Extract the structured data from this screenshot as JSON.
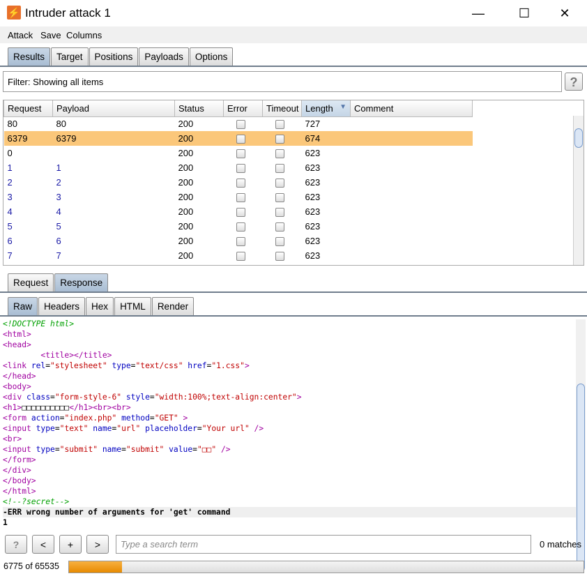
{
  "window": {
    "title": "Intruder attack 1",
    "minimize": "—",
    "maximize": "☐",
    "close": "✕"
  },
  "menu": [
    "Attack",
    "Save",
    "Columns"
  ],
  "tabs": [
    "Results",
    "Target",
    "Positions",
    "Payloads",
    "Options"
  ],
  "filter": {
    "text": "Filter: Showing all items",
    "help": "?"
  },
  "table": {
    "columns": [
      "Request",
      "Payload",
      "Status",
      "Error",
      "Timeout",
      "Length",
      "Comment"
    ],
    "sort_column": "Length",
    "sort_icon": "▼",
    "rows": [
      {
        "request": "80",
        "payload": "80",
        "status": "200",
        "length": "727",
        "selected": false
      },
      {
        "request": "6379",
        "payload": "6379",
        "status": "200",
        "length": "674",
        "selected": true
      },
      {
        "request": "0",
        "payload": "",
        "status": "200",
        "length": "623",
        "selected": false
      },
      {
        "request": "1",
        "payload": "1",
        "status": "200",
        "length": "623",
        "selected": false
      },
      {
        "request": "2",
        "payload": "2",
        "status": "200",
        "length": "623",
        "selected": false
      },
      {
        "request": "3",
        "payload": "3",
        "status": "200",
        "length": "623",
        "selected": false
      },
      {
        "request": "4",
        "payload": "4",
        "status": "200",
        "length": "623",
        "selected": false
      },
      {
        "request": "5",
        "payload": "5",
        "status": "200",
        "length": "623",
        "selected": false
      },
      {
        "request": "6",
        "payload": "6",
        "status": "200",
        "length": "623",
        "selected": false
      },
      {
        "request": "7",
        "payload": "7",
        "status": "200",
        "length": "623",
        "selected": false
      }
    ]
  },
  "reqresp_tabs": [
    "Request",
    "Response"
  ],
  "view_tabs": [
    "Raw",
    "Headers",
    "Hex",
    "HTML",
    "Render"
  ],
  "code": [
    [
      [
        "com",
        "<!DOCTYPE html>"
      ]
    ],
    [
      [
        "tag",
        "<html>"
      ]
    ],
    [
      [
        "tag",
        "<head>"
      ]
    ],
    [
      [
        "plain",
        "        "
      ],
      [
        "tag",
        "<title></title>"
      ]
    ],
    [
      [
        "tag",
        "<link "
      ],
      [
        "attr",
        "rel"
      ],
      [
        "plain",
        "="
      ],
      [
        "val",
        "\"stylesheet\""
      ],
      [
        "attr",
        " type"
      ],
      [
        "plain",
        "="
      ],
      [
        "val",
        "\"text/css\""
      ],
      [
        "attr",
        " href"
      ],
      [
        "plain",
        "="
      ],
      [
        "val",
        "\"1.css\""
      ],
      [
        "tag",
        ">"
      ]
    ],
    [
      [
        "tag",
        "</head>"
      ]
    ],
    [
      [
        "tag",
        "<body>"
      ]
    ],
    [
      [
        "tag",
        "<div "
      ],
      [
        "attr",
        "class"
      ],
      [
        "plain",
        "="
      ],
      [
        "val",
        "\"form-style-6\""
      ],
      [
        "attr",
        " style"
      ],
      [
        "plain",
        "="
      ],
      [
        "val",
        "\"width:100%;text-align:center\""
      ],
      [
        "tag",
        ">"
      ]
    ],
    [
      [
        "tag",
        "<h1>"
      ],
      [
        "plain",
        "□□□□□□□□□□"
      ],
      [
        "tag",
        "</h1><br><br>"
      ]
    ],
    [
      [
        "tag",
        "<form "
      ],
      [
        "attr",
        "action"
      ],
      [
        "plain",
        "="
      ],
      [
        "val",
        "\"index.php\""
      ],
      [
        "attr",
        " method"
      ],
      [
        "plain",
        "="
      ],
      [
        "val",
        "\"GET\""
      ],
      [
        "tag",
        " >"
      ]
    ],
    [
      [
        "tag",
        "<input "
      ],
      [
        "attr",
        "type"
      ],
      [
        "plain",
        "="
      ],
      [
        "val",
        "\"text\""
      ],
      [
        "attr",
        " name"
      ],
      [
        "plain",
        "="
      ],
      [
        "val",
        "\"url\""
      ],
      [
        "attr",
        " placeholder"
      ],
      [
        "plain",
        "="
      ],
      [
        "val",
        "\"Your url\""
      ],
      [
        "tag",
        " />"
      ]
    ],
    [
      [
        "tag",
        "<br>"
      ]
    ],
    [
      [
        "tag",
        "<input "
      ],
      [
        "attr",
        "type"
      ],
      [
        "plain",
        "="
      ],
      [
        "val",
        "\"submit\""
      ],
      [
        "attr",
        " name"
      ],
      [
        "plain",
        "="
      ],
      [
        "val",
        "\"submit\""
      ],
      [
        "attr",
        " value"
      ],
      [
        "plain",
        "="
      ],
      [
        "val",
        "\"□□\""
      ],
      [
        "tag",
        " />"
      ]
    ],
    [
      [
        "tag",
        "</form>"
      ]
    ],
    [
      [
        "tag",
        "</div>"
      ]
    ],
    [
      [
        "tag",
        "</body>"
      ]
    ],
    [
      [
        "tag",
        "</html>"
      ]
    ],
    [
      [
        "com",
        "<!--?secret-->"
      ]
    ],
    [
      [
        "bold",
        "-ERR wrong number of arguments for 'get' command"
      ]
    ],
    [
      [
        "bold",
        "1"
      ]
    ]
  ],
  "search": {
    "help": "?",
    "prev": "<",
    "add": "+",
    "next": ">",
    "placeholder": "Type a search term",
    "matches": "0 matches"
  },
  "progress": {
    "text": "6775 of 65535",
    "done": 6775,
    "total": 65535
  },
  "colors": {
    "accent": "#e88a00",
    "selected_row": "#fbc77a",
    "tag": "#a000a0",
    "attr": "#0000c0",
    "value": "#c00000",
    "comment": "#00a000"
  }
}
